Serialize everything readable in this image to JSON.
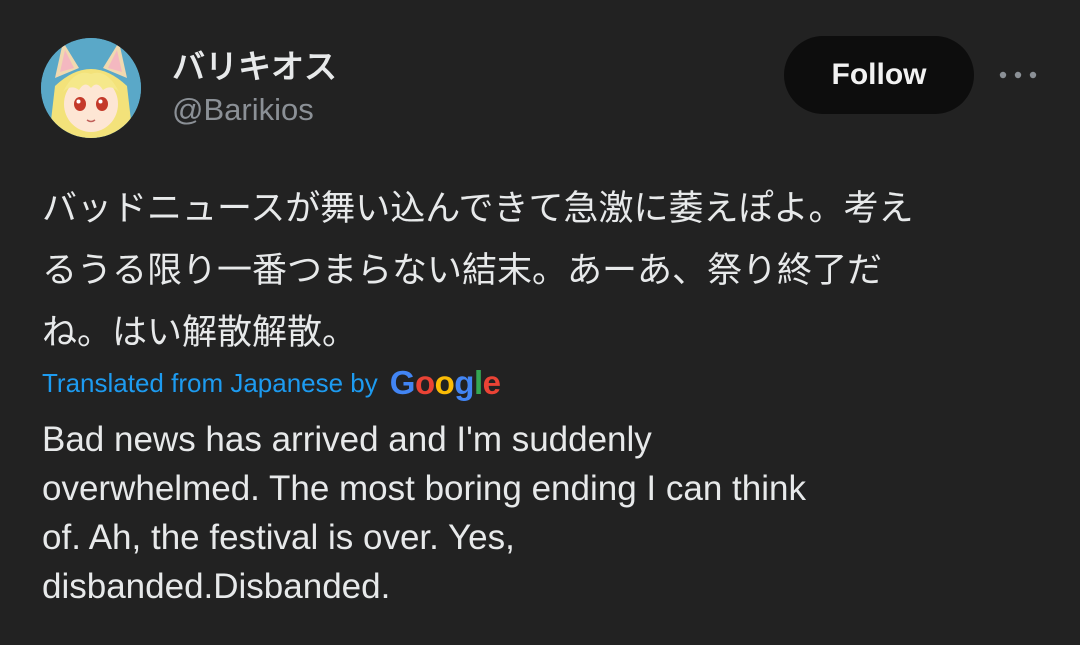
{
  "author": {
    "display_name": "バリキオス",
    "handle": "@Barikios",
    "avatar_icon": "anime-character-avatar"
  },
  "actions": {
    "follow_label": "Follow",
    "more_icon": "more-options-icon"
  },
  "tweet": {
    "lines": [
      "バッドニュースが舞い込んできて急激に萎えぽよ。考え",
      "るうる限り一番つまらない結末。あーあ、祭り終了だ",
      "ね。はい解散解散。"
    ]
  },
  "translation": {
    "label": "Translated from Japanese by",
    "provider": "Google",
    "lines": [
      "Bad news has arrived and I'm suddenly",
      "overwhelmed. The most boring ending I can think",
      "of. Ah, the festival is over. Yes,",
      "disbanded.Disbanded."
    ]
  },
  "colors": {
    "background": "#222222",
    "text": "#e7e9ea",
    "secondary_text": "#8b9096",
    "link": "#1d9bf0",
    "follow_button_bg": "#0d0d0d"
  }
}
